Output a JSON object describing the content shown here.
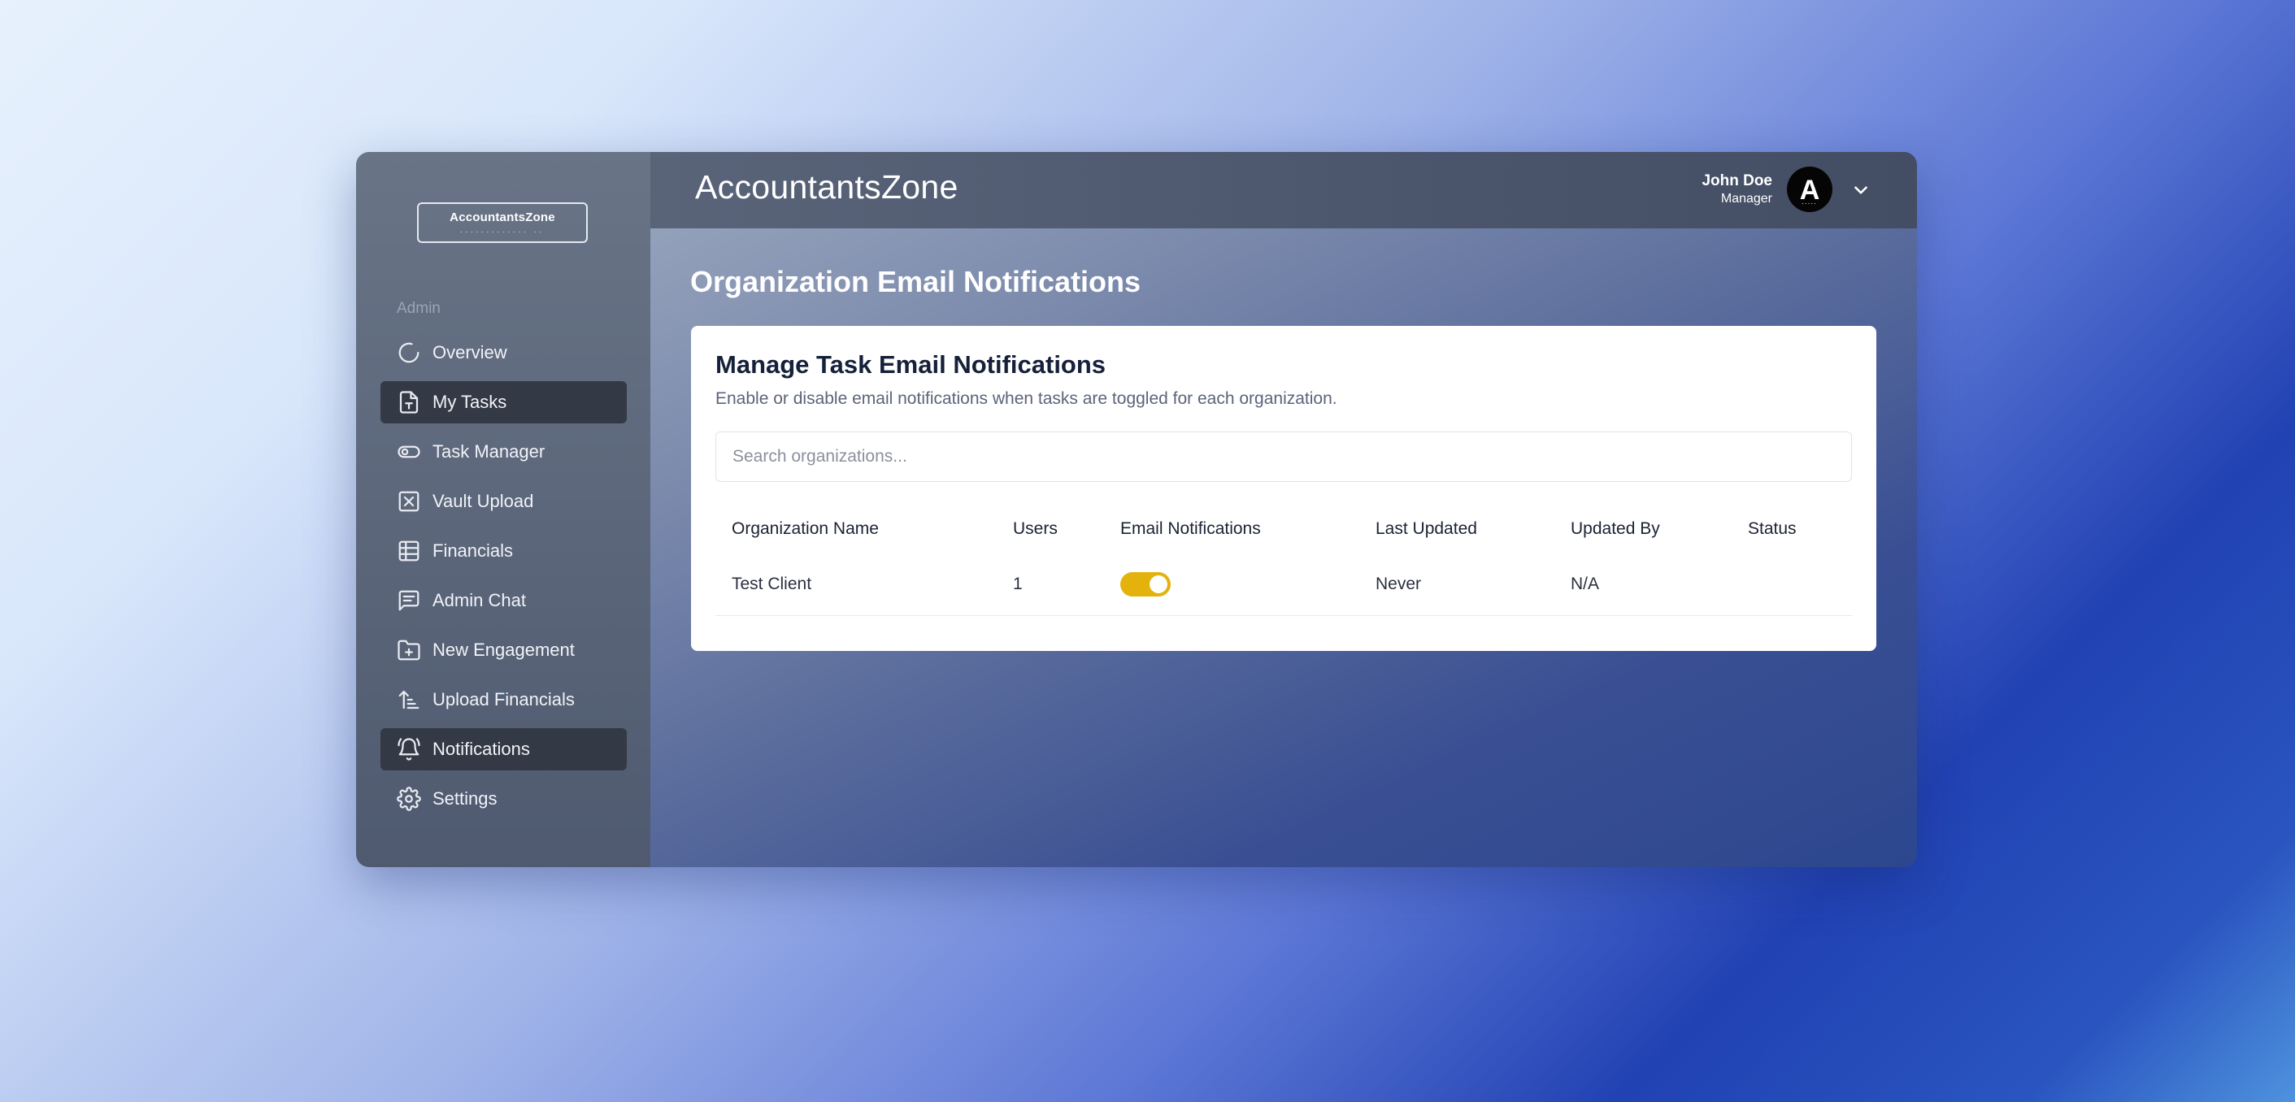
{
  "sidebar": {
    "logo_title": "AccountantsZone",
    "logo_sub": "............. ..",
    "section_label": "Admin",
    "items": [
      {
        "label": "Overview",
        "icon": "loader-circle-icon",
        "active": false
      },
      {
        "label": "My Tasks",
        "icon": "file-text-icon",
        "active": true
      },
      {
        "label": "Task Manager",
        "icon": "toggle-icon",
        "active": false
      },
      {
        "label": "Vault Upload",
        "icon": "box-x-icon",
        "active": false
      },
      {
        "label": "Financials",
        "icon": "table-icon",
        "active": false
      },
      {
        "label": "Admin Chat",
        "icon": "message-square-icon",
        "active": false
      },
      {
        "label": "New Engagement",
        "icon": "folder-plus-icon",
        "active": false
      },
      {
        "label": "Upload Financials",
        "icon": "sort-upload-icon",
        "active": false
      },
      {
        "label": "Notifications",
        "icon": "bell-ring-icon",
        "active": true
      },
      {
        "label": "Settings",
        "icon": "gear-icon",
        "active": false
      }
    ]
  },
  "header": {
    "app_title": "AccountantsZone",
    "user_name": "John Doe",
    "user_role": "Manager",
    "avatar_letter": "A",
    "avatar_dots": "....."
  },
  "page": {
    "title": "Organization Email Notifications"
  },
  "card": {
    "title": "Manage Task Email Notifications",
    "description": "Enable or disable email notifications when tasks are toggled for each organization.",
    "search_placeholder": "Search organizations...",
    "columns": [
      "Organization Name",
      "Users",
      "Email Notifications",
      "Last Updated",
      "Updated By",
      "Status"
    ],
    "rows": [
      {
        "organization": "Test Client",
        "users": "1",
        "email_notifications": true,
        "last_updated": "Never",
        "updated_by": "N/A",
        "status": ""
      }
    ]
  },
  "colors": {
    "toggle_on": "#e3b20c",
    "active_nav": "#343a45"
  }
}
